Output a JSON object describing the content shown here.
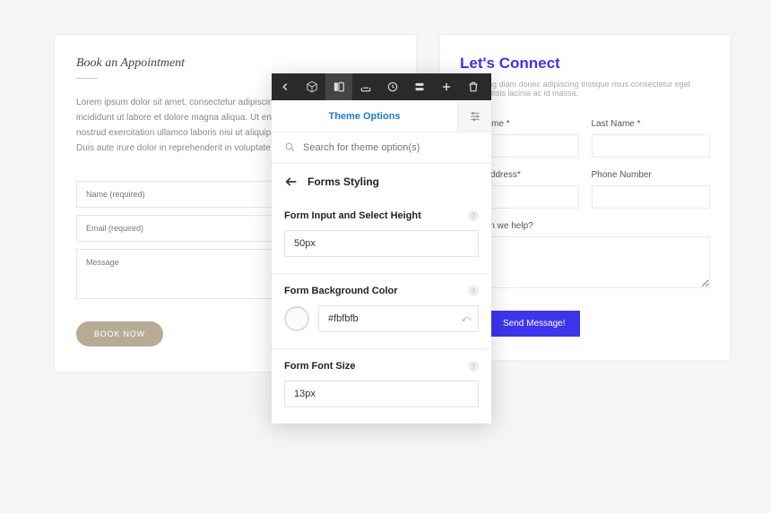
{
  "left": {
    "title": "Book an Appointment",
    "desc": "Lorem ipsum dolor sit amet, consectetur adipiscing elit, sed do eiusmod tempor incididunt ut labore et dolore magna aliqua. Ut enim ad minim veniam, quis nostrud exercitation ullamco laboris nisi ut aliquip ex ea commodo consequat. Duis aute irure dolor in reprehenderit in voluptate velit.",
    "name_ph": "Name (required)",
    "email_ph": "Email (required)",
    "message_ph": "Message",
    "button": "BOOK NOW"
  },
  "right": {
    "title": "Let's Connect",
    "desc": "Adipiscing diam donec adipiscing tristique risus consectetur eget diam facilisis lacinia ac id massa.",
    "first_name": "First Name *",
    "last_name": "Last Name *",
    "email": "Email Address*",
    "phone": "Phone Number",
    "help": "How can we help?",
    "button": "Send Message!"
  },
  "panel": {
    "tab": "Theme Options",
    "search_ph": "Search for theme option(s)",
    "section": "Forms Styling",
    "opt1_label": "Form Input and Select Height",
    "opt1_value": "50px",
    "opt2_label": "Form Background Color",
    "opt2_value": "#fbfbfb",
    "opt3_label": "Form Font Size",
    "opt3_value": "13px"
  }
}
